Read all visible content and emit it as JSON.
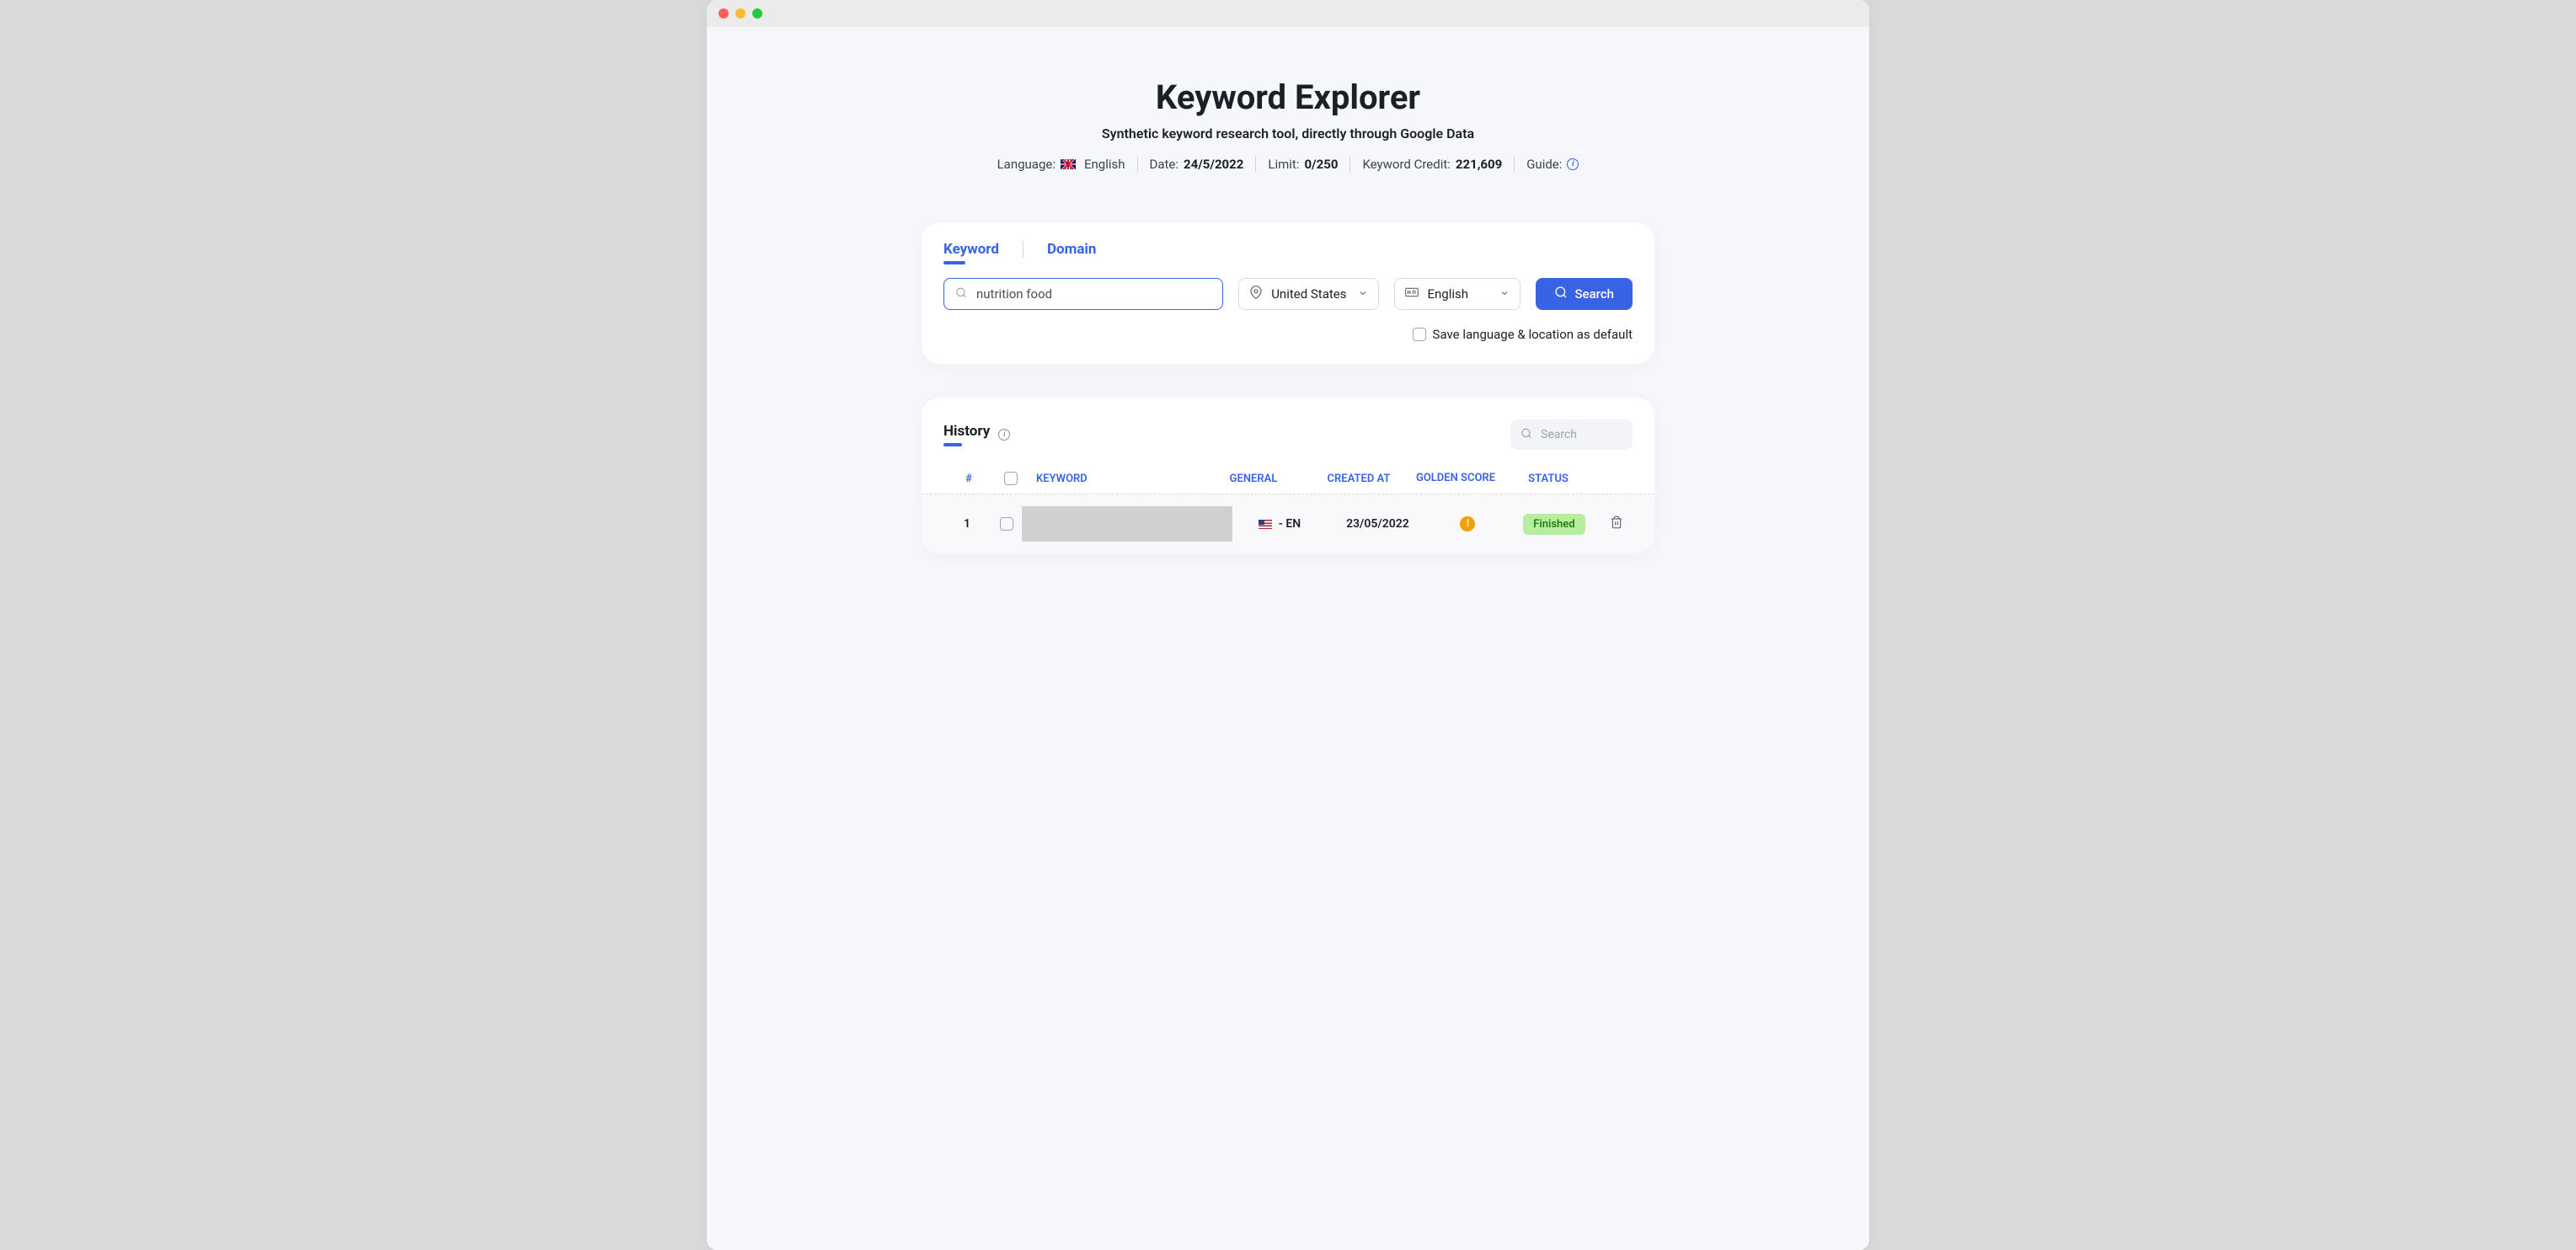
{
  "header": {
    "title": "Keyword Explorer",
    "subtitle": "Synthetic keyword research tool, directly through Google Data",
    "meta": {
      "language_label": "Language:",
      "language_value": "English",
      "date_label": "Date:",
      "date_value": "24/5/2022",
      "limit_label": "Limit:",
      "limit_value": "0/250",
      "credit_label": "Keyword Credit:",
      "credit_value": "221,609",
      "guide_label": "Guide:"
    }
  },
  "search": {
    "tabs": {
      "keyword": "Keyword",
      "domain": "Domain"
    },
    "input_value": "nutrition food",
    "country": "United States",
    "language": "English",
    "button": "Search",
    "save_label": "Save language & location as default"
  },
  "history": {
    "title": "History",
    "search_placeholder": "Search",
    "columns": {
      "num": "#",
      "keyword": "KEYWORD",
      "general": "GENERAL",
      "created": "CREATED AT",
      "golden": "GOLDEN SCORE",
      "status": "STATUS"
    },
    "rows": [
      {
        "num": "1",
        "general_lang": "-  EN",
        "created": "23/05/2022",
        "status": "Finished"
      }
    ]
  }
}
